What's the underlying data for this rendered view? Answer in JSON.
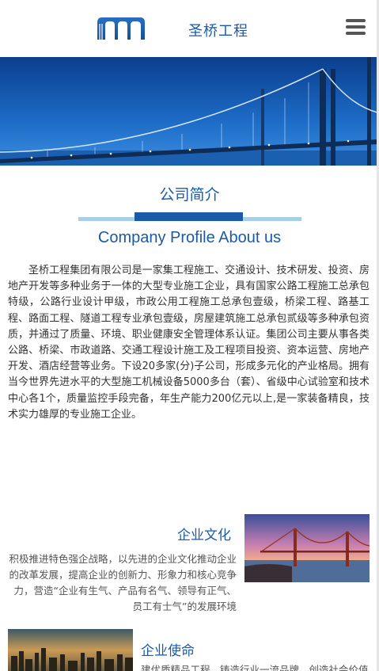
{
  "header": {
    "brand": "圣桥工程",
    "logo_icon": "bridge-arches-logo-icon",
    "menu_icon": "hamburger-menu-icon"
  },
  "banner": {
    "image": "bay-bridge-photo"
  },
  "profile": {
    "title": "公司简介",
    "subtitle": "Company Profile About us",
    "body": "圣桥工程集团有限公司是一家集工程施工、交通设计、技术研发、投资、房地产开发等多种业务于一体的大型专业施工企业，具有国家公路工程施工总承包特级，公路行业设计甲级，市政公用工程施工总承包壹级，桥梁工程、路基工程、路面工程、隧道工程专业承包壹级，房屋建筑施工总承包贰级等多种承包资质，并通过了质量、环境、职业健康安全管理体系认证。集团公司主要从事各类公路、桥梁、市政道路、交通工程设计施工及工程项目投资、资本运营、房地产开发、酒店经营等业务。下设20多家(分)子公司，形成多元化的产业格局。拥有当今世界先进水平的大型施工机械设备5000多台（套）、省级中心试验室和技术中心各1个，质量监控手段完备，年生产能力200亿元以上,是一家装备精良，技术实力雄厚的专业施工企业。"
  },
  "culture": {
    "title": "企业文化",
    "body": "积极推进特色强企战略，以先进的企业文化推动企业的改革发展，提高企业的创新力、形象力和核心竞争力，营造“企业有生气、产品有名气、领导有正气、员工有士气”的发展环境",
    "image": "golden-gate-bridge-sunset-photo"
  },
  "mission": {
    "title": "企业使命",
    "body": "建优质精品工程，铸造行业一流品牌，创造社会价值",
    "image": "city-skyline-photo"
  },
  "colors": {
    "accent": "#1a5aa6",
    "accent_light": "#a9cfe8"
  }
}
